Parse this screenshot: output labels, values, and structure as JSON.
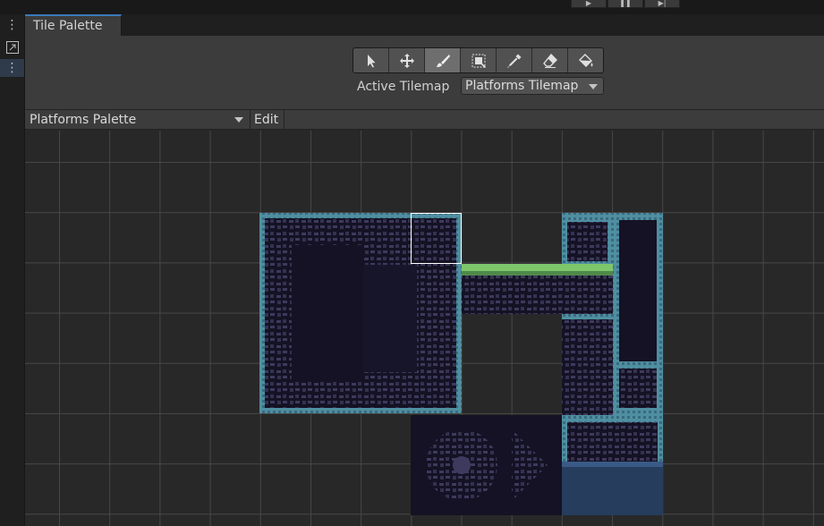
{
  "window": {
    "tab_title": "Tile Palette"
  },
  "playmode": {
    "buttons": [
      {
        "name": "play-button",
        "glyph": "▶"
      },
      {
        "name": "pause-button",
        "glyph": "❚❚"
      },
      {
        "name": "step-button",
        "glyph": "▶|"
      }
    ]
  },
  "left_strip": {
    "menu_glyph": "⋮",
    "maximize_icon": "maximize-icon",
    "more_glyph": "⋮"
  },
  "toolbar": {
    "tools": [
      {
        "name": "select-tool",
        "icon": "arrow-pointer-icon",
        "active": false
      },
      {
        "name": "move-tool",
        "icon": "move-arrows-icon",
        "active": false
      },
      {
        "name": "paint-tool",
        "icon": "brush-icon",
        "active": true
      },
      {
        "name": "box-fill-tool",
        "icon": "box-fill-icon",
        "active": false
      },
      {
        "name": "picker-tool",
        "icon": "eyedropper-icon",
        "active": false
      },
      {
        "name": "erase-tool",
        "icon": "eraser-icon",
        "active": false
      },
      {
        "name": "flood-fill-tool",
        "icon": "paint-bucket-icon",
        "active": false
      }
    ],
    "active_tilemap_label": "Active Tilemap",
    "active_tilemap_value": "Platforms Tilemap"
  },
  "palette": {
    "selected_palette": "Platforms Palette",
    "edit_label": "Edit"
  },
  "colors": {
    "tab_accent": "#3a79bb",
    "tile_dark": "#141224",
    "tile_stone": "#3e3a5e",
    "tile_edge": "#4f8fa0",
    "tile_grass": "#7ec66a",
    "tile_water": "#263d5e"
  }
}
